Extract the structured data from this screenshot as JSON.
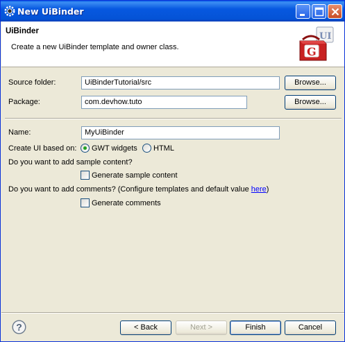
{
  "window": {
    "title": "New UiBinder"
  },
  "banner": {
    "title": "UiBinder",
    "description": "Create a new UiBinder template and owner class.",
    "logo_icon": "gwt-toolbox-icon"
  },
  "form": {
    "source_folder": {
      "label": "Source folder:",
      "value": "UiBinderTutorial/src",
      "browse": "Browse..."
    },
    "package": {
      "label": "Package:",
      "value": "com.devhow.tuto",
      "browse": "Browse..."
    },
    "name": {
      "label": "Name:",
      "value": "MyUiBinder"
    },
    "create_ui": {
      "label": "Create UI based on:",
      "options": [
        {
          "label": "GWT widgets",
          "selected": true
        },
        {
          "label": "HTML",
          "selected": false
        }
      ]
    },
    "sample": {
      "question": "Do you want to add sample content?",
      "checkbox_label": "Generate sample content",
      "checked": false
    },
    "comments": {
      "question_prefix": "Do you want to add comments? (Configure templates and default value ",
      "link": "here",
      "question_suffix": ")",
      "checkbox_label": "Generate comments",
      "checked": false
    }
  },
  "footer": {
    "help_icon": "help-icon",
    "back": "< Back",
    "next": "Next >",
    "finish": "Finish",
    "cancel": "Cancel"
  },
  "colors": {
    "titlebar": "#0758e0",
    "dialog_bg": "#ece9d8",
    "radio_dot": "#21a121",
    "link": "#0000ff"
  }
}
